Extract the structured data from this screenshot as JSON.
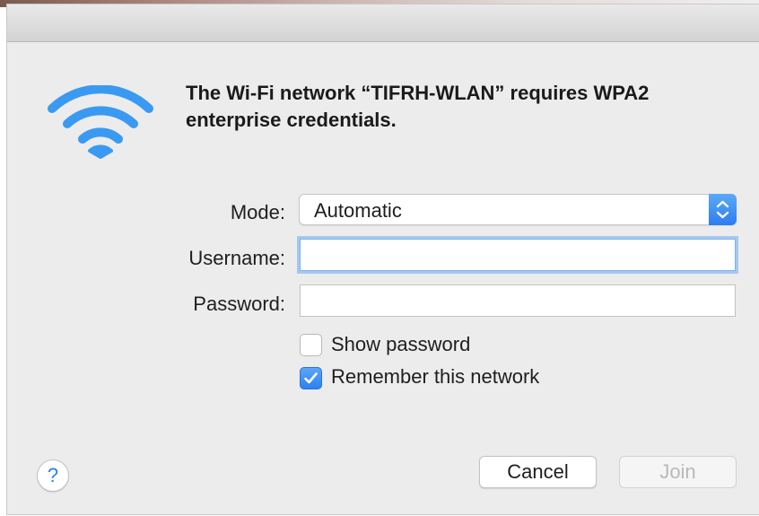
{
  "dialog": {
    "heading": "The Wi-Fi network “TIFRH-WLAN” requires WPA2 enterprise credentials.",
    "icon": "wifi-icon"
  },
  "form": {
    "mode_label": "Mode:",
    "mode_value": "Automatic",
    "username_label": "Username:",
    "username_value": "",
    "password_label": "Password:",
    "password_value": ""
  },
  "options": {
    "show_password": {
      "label": "Show password",
      "checked": false
    },
    "remember_network": {
      "label": "Remember this network",
      "checked": true
    }
  },
  "buttons": {
    "help": "?",
    "cancel": "Cancel",
    "join": "Join"
  },
  "colors": {
    "accent": "#2d7ff0",
    "wifi": "#3a9af2",
    "background": "#ececec"
  }
}
